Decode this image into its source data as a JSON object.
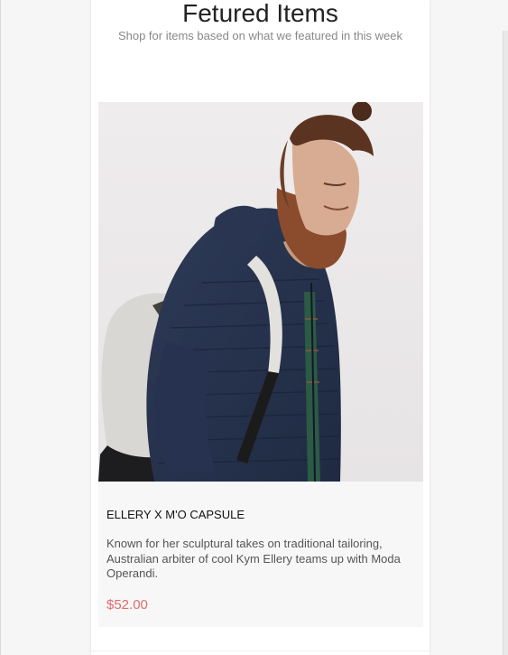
{
  "section": {
    "title": "Fetured Items",
    "subtitle": "Shop for items based on what we featured in this week"
  },
  "product": {
    "image_icon": "product-photo",
    "name": "ELLERY X M'O CAPSULE",
    "description": "Known for her sculptural takes on traditional tailoring, Australian arbiter of cool Kym Ellery teams up with Moda Operandi.",
    "price": "$52.00",
    "price_color": "#e06c6c"
  }
}
